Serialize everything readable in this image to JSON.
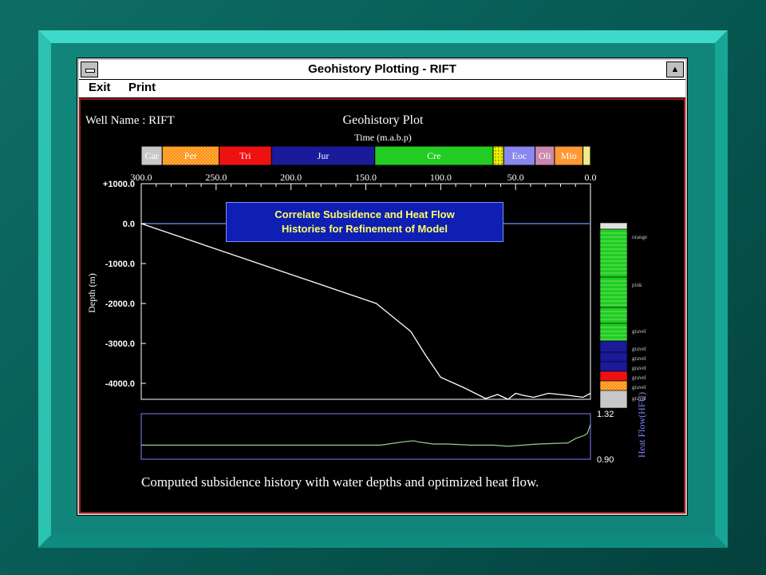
{
  "window": {
    "title": "Geohistory Plotting - RIFT",
    "maximize_glyph": "▲"
  },
  "menu": {
    "exit_label": "Exit",
    "print_label": "Print"
  },
  "plot": {
    "well_label": "Well Name :  RIFT",
    "title": "Geohistory Plot",
    "time_label": "Time (m.a.b.p)",
    "depth_label": "Depth (m)",
    "heatflow_label": "Heat Flow(HFU)",
    "caption": "Computed subsidence history with water depths and optimized heat flow.",
    "overlay_line1": "Correlate Subsidence and Heat Flow",
    "overlay_line2": "Histories for Refinement of Model"
  },
  "colors": {
    "axis": "#ffffff",
    "sea_level": "#5a7fd0",
    "curve": "#ffffff",
    "heatflow_frame": "#8080ff",
    "heatflow_curve": "#8fd08f",
    "overlay_bg": "#0f1eb3",
    "overlay_text": "#ffff66"
  },
  "periods": [
    {
      "label": "Car",
      "start": 300,
      "end": 286,
      "color": "#c8c8c8",
      "pattern": false
    },
    {
      "label": "Per",
      "start": 286,
      "end": 248,
      "color": "#ff8a1e",
      "pattern": true
    },
    {
      "label": "Tri",
      "start": 248,
      "end": 213,
      "color": "#ee1111",
      "pattern": false
    },
    {
      "label": "Jur",
      "start": 213,
      "end": 144,
      "color": "#1a1a9a",
      "pattern": false
    },
    {
      "label": "Cre",
      "start": 144,
      "end": 65,
      "color": "#22cc22",
      "pattern": false
    },
    {
      "label": "",
      "start": 65,
      "end": 58,
      "color": "#eeee00",
      "pattern": true
    },
    {
      "label": "Eoc",
      "start": 58,
      "end": 37,
      "color": "#8888ee",
      "pattern": false
    },
    {
      "label": "Oli",
      "start": 37,
      "end": 24,
      "color": "#cc88aa",
      "pattern": false
    },
    {
      "label": "Mio",
      "start": 24,
      "end": 5,
      "color": "#ff9933",
      "pattern": false
    },
    {
      "label": "",
      "start": 5,
      "end": 0,
      "color": "#eeee88",
      "pattern": false
    }
  ],
  "chart_data": [
    {
      "type": "line",
      "title": "Geohistory Plot",
      "xlabel": "Time (m.a.b.p)",
      "ylabel": "Depth (m)",
      "xlim": [
        300,
        0
      ],
      "ylim": [
        1000,
        -4400
      ],
      "x_ticks": [
        "300.0",
        "250.0",
        "200.0",
        "150.0",
        "100.0",
        "50.0",
        "0.0"
      ],
      "y_ticks": [
        "+1000.0",
        "0.0",
        "-1000.0",
        "-2000.0",
        "-3000.0",
        "-4000.0"
      ],
      "series": [
        {
          "x": [
            300,
            143,
            120,
            110,
            100,
            85,
            70,
            62,
            55,
            50,
            45,
            38,
            28,
            15,
            5,
            0
          ],
          "y": [
            0,
            -2000,
            -2700,
            -3300,
            -3850,
            -4100,
            -4380,
            -4280,
            -4400,
            -4250,
            -4300,
            -4350,
            -4250,
            -4300,
            -4350,
            -4250
          ]
        }
      ]
    },
    {
      "type": "line",
      "title": "",
      "ylabel": "Heat Flow(HFU)",
      "xlim": [
        300,
        0
      ],
      "ylim": [
        0.9,
        1.32
      ],
      "y_ticks": [
        "1.32",
        "0.90"
      ],
      "series": [
        {
          "x": [
            300,
            140,
            130,
            125,
            118,
            115,
            110,
            105,
            95,
            80,
            65,
            55,
            45,
            35,
            15,
            10,
            8,
            4,
            2,
            0
          ],
          "y": [
            1.03,
            1.03,
            1.05,
            1.06,
            1.07,
            1.06,
            1.05,
            1.04,
            1.04,
            1.03,
            1.03,
            1.02,
            1.03,
            1.04,
            1.05,
            1.09,
            1.1,
            1.12,
            1.14,
            1.22
          ]
        }
      ]
    }
  ],
  "lithology": {
    "cells": [
      {
        "color": "#e0e0e0",
        "pattern": false,
        "label": ""
      },
      {
        "color": "#22cc22",
        "pattern": false,
        "label": "orange"
      },
      {
        "color": "#22cc22",
        "pattern": false,
        "label": "pink"
      },
      {
        "color": "#22cc22",
        "pattern": false,
        "label": ""
      },
      {
        "color": "#22cc22",
        "pattern": false,
        "label": "gravel"
      },
      {
        "color": "#1a1a9a",
        "pattern": false,
        "label": "gravel"
      },
      {
        "color": "#1a1a9a",
        "pattern": false,
        "label": "gravel"
      },
      {
        "color": "#1a1a9a",
        "pattern": false,
        "label": "gravel"
      },
      {
        "color": "#ee1111",
        "pattern": false,
        "label": "gravel"
      },
      {
        "color": "#ff8a1e",
        "pattern": true,
        "label": "gravel"
      },
      {
        "color": "#c8c8c8",
        "pattern": false,
        "label": "gravel"
      }
    ]
  }
}
